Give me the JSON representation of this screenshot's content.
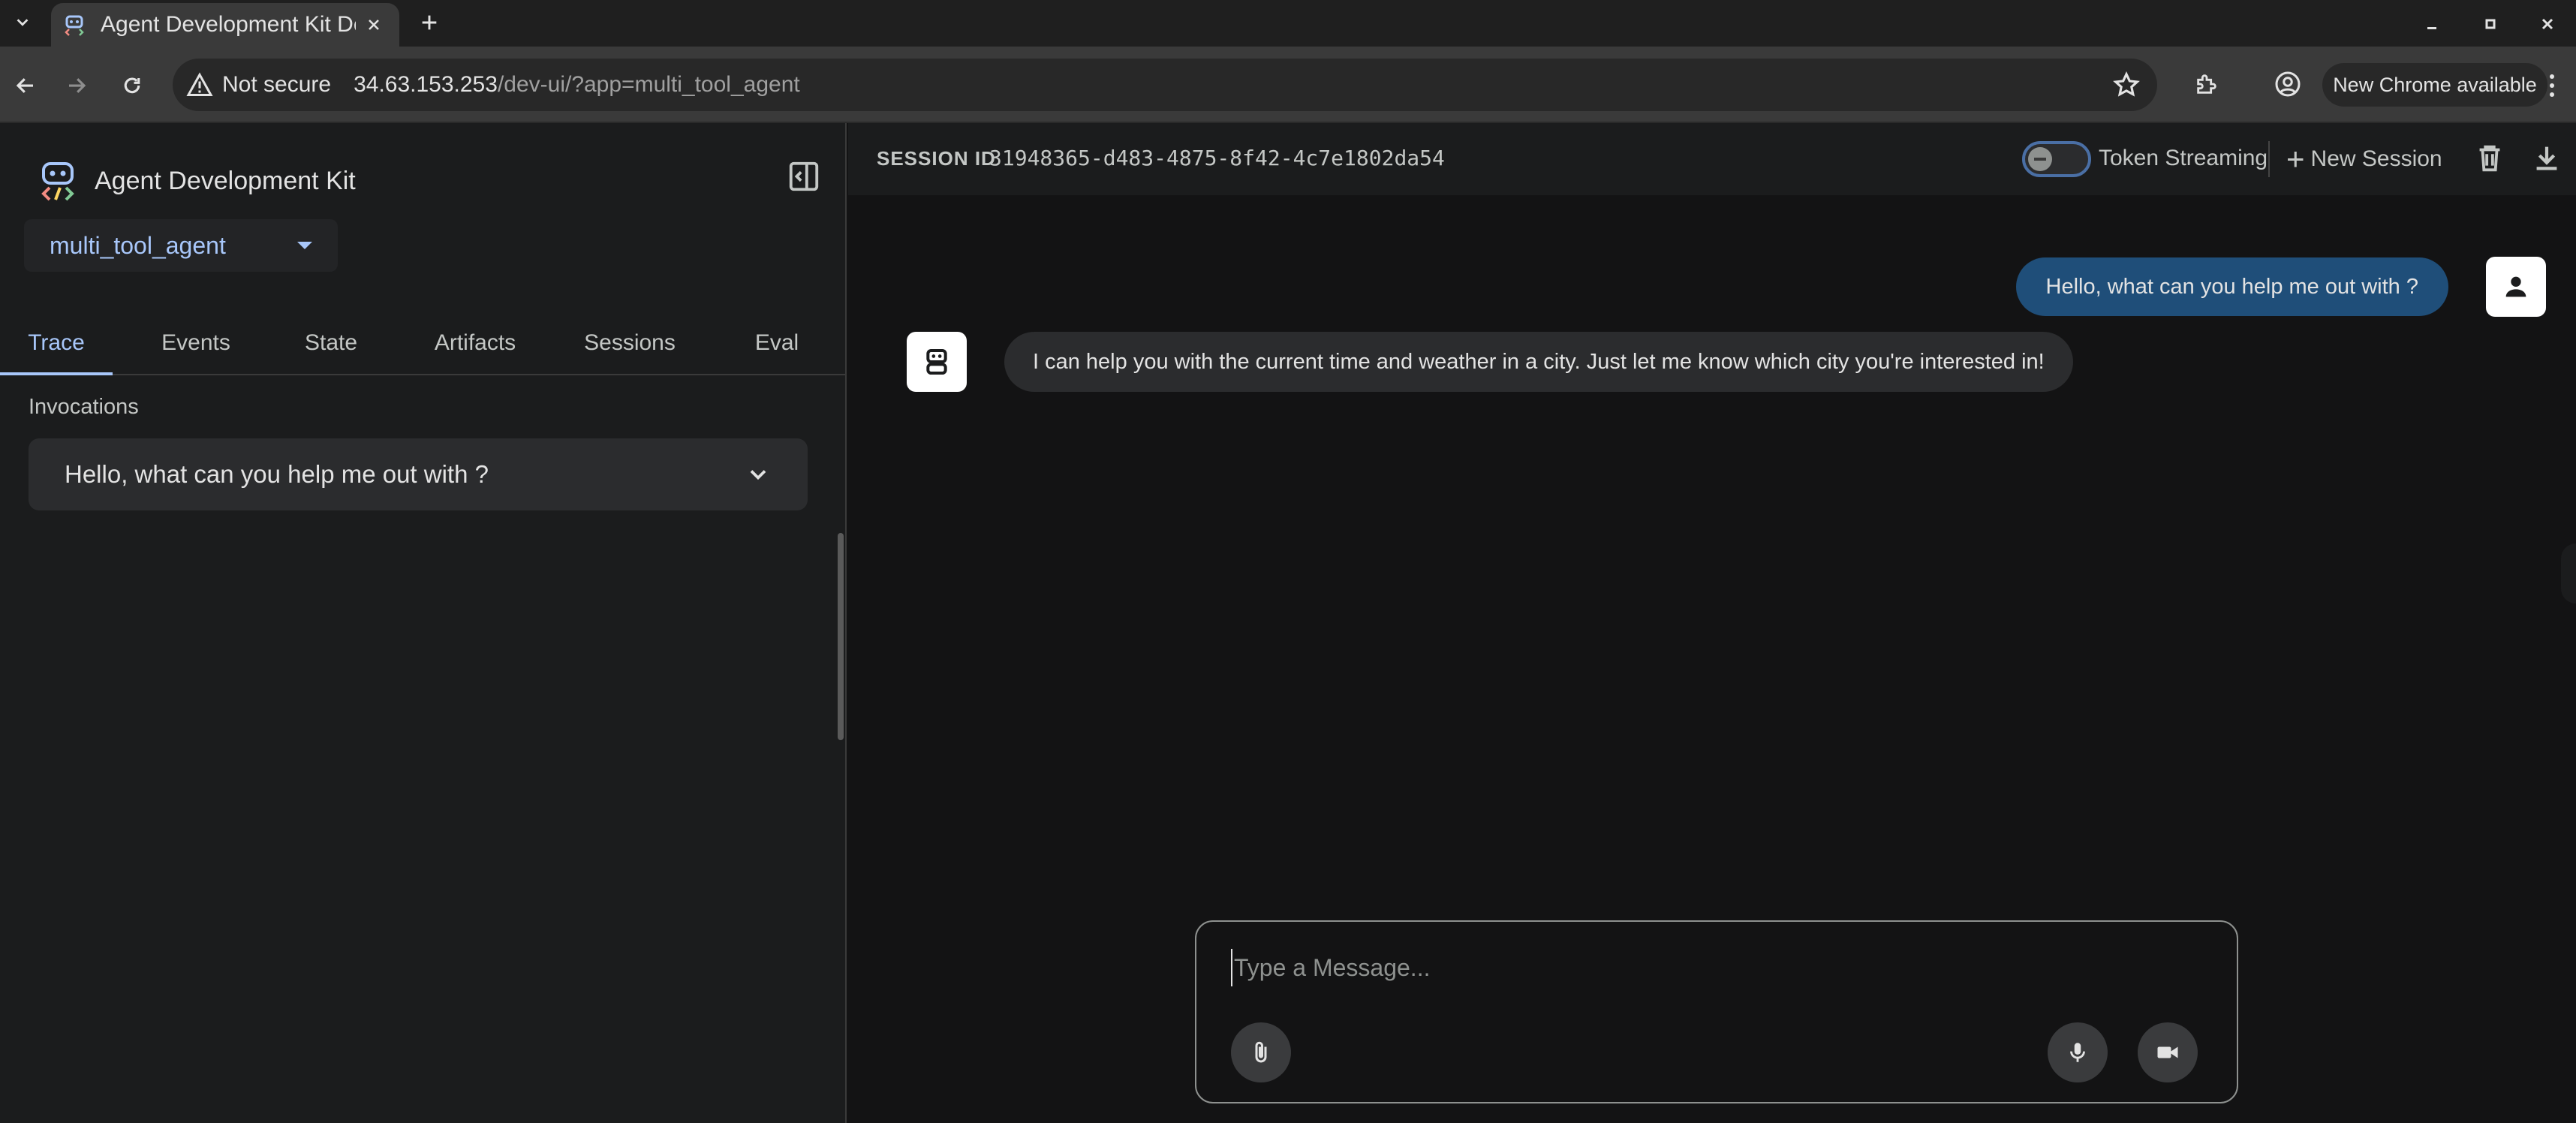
{
  "browser": {
    "tab_title": "Agent Development Kit Dev UI",
    "security_label": "Not secure",
    "url_host": "34.63.153.253",
    "url_path": "/dev-ui/?app=multi_tool_agent",
    "update_label": "New Chrome available"
  },
  "sidebar": {
    "brand": "Agent Development Kit",
    "selected_agent": "multi_tool_agent",
    "tabs": [
      {
        "label": "Trace"
      },
      {
        "label": "Events"
      },
      {
        "label": "State"
      },
      {
        "label": "Artifacts"
      },
      {
        "label": "Sessions"
      },
      {
        "label": "Eval"
      }
    ],
    "active_tab": "Trace",
    "invocations_label": "Invocations",
    "invocations": [
      {
        "label": "Hello, what can you help me out with ?"
      }
    ]
  },
  "header": {
    "session_label": "SESSION ID",
    "session_id": "31948365-d483-4875-8f42-4c7e1802da54",
    "token_streaming_label": "Token Streaming",
    "token_streaming_on": false,
    "new_session_label": "New Session"
  },
  "chat": {
    "messages": [
      {
        "role": "user",
        "text": "Hello, what can you help me out with ?"
      },
      {
        "role": "bot",
        "text": "I can help you with the current time and weather in a city. Just let me know which city you're interested in!"
      }
    ]
  },
  "composer": {
    "placeholder": "Type a Message...",
    "value": ""
  },
  "icons": {
    "attach": "paperclip-icon",
    "mic": "microphone-icon",
    "video": "videocam-icon",
    "user": "person-icon",
    "bot": "robot-icon"
  }
}
